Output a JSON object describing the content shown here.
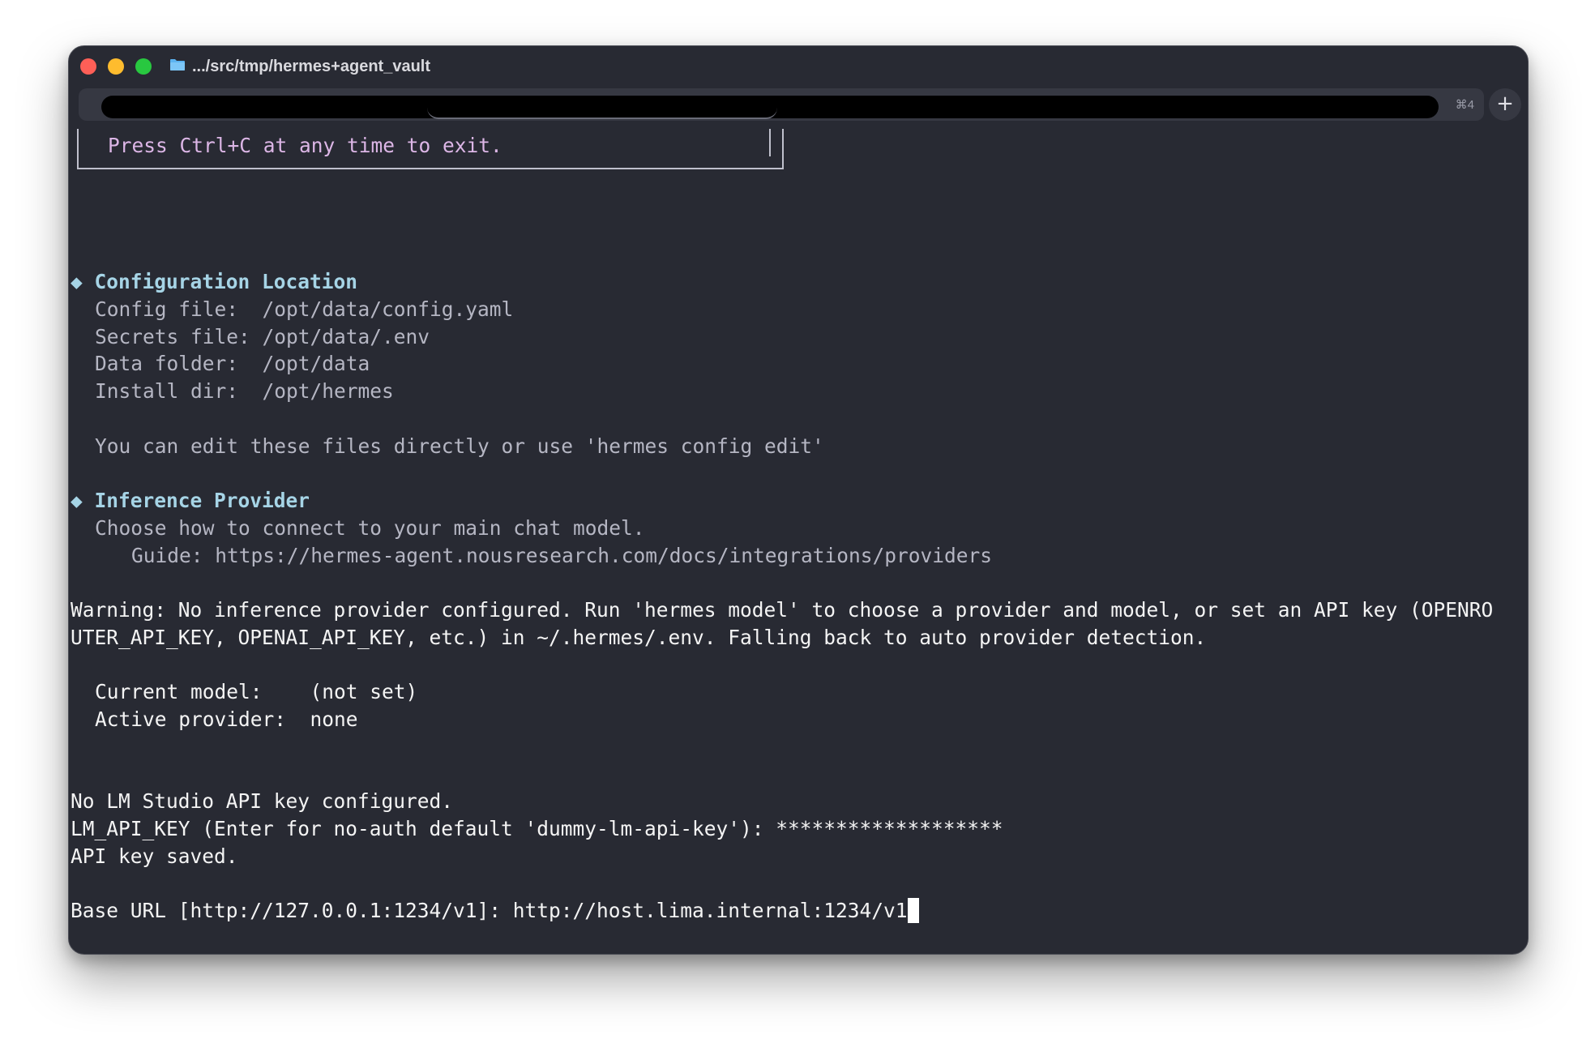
{
  "window": {
    "title": ".../src/tmp/hermes+agent_vault",
    "tab_shortcut": "⌘4",
    "new_tab_label": "+"
  },
  "terminal": {
    "box_text": "Press Ctrl+C at any time to exit.",
    "config_section": {
      "marker": "◆",
      "heading": "Configuration Location",
      "config_file": "Config file:  /opt/data/config.yaml",
      "secrets_file": "Secrets file: /opt/data/.env",
      "data_folder": "Data folder:  /opt/data",
      "install_dir": "Install dir:  /opt/hermes",
      "edit_hint": "You can edit these files directly or use 'hermes config edit'"
    },
    "provider_section": {
      "marker": "◆",
      "heading": "Inference Provider",
      "description": "Choose how to connect to your main chat model.",
      "guide": "Guide: https://hermes-agent.nousresearch.com/docs/integrations/providers"
    },
    "warning_line1": "Warning: No inference provider configured. Run 'hermes model' to choose a provider and model, or set an API key (OPENRO",
    "warning_line2": "UTER_API_KEY, OPENAI_API_KEY, etc.) in ~/.hermes/.env. Falling back to auto provider detection.",
    "current_model": "Current model:    (not set)",
    "active_provider": "Active provider:  none",
    "no_key": "No LM Studio API key configured.",
    "api_key_prompt": "LM_API_KEY (Enter for no-auth default 'dummy-lm-api-key'): *******************",
    "api_key_saved": "API key saved.",
    "base_url_prompt": "Base URL [http://127.0.0.1:1234/v1]: ",
    "base_url_input": "http://host.lima.internal:1234/v1"
  }
}
